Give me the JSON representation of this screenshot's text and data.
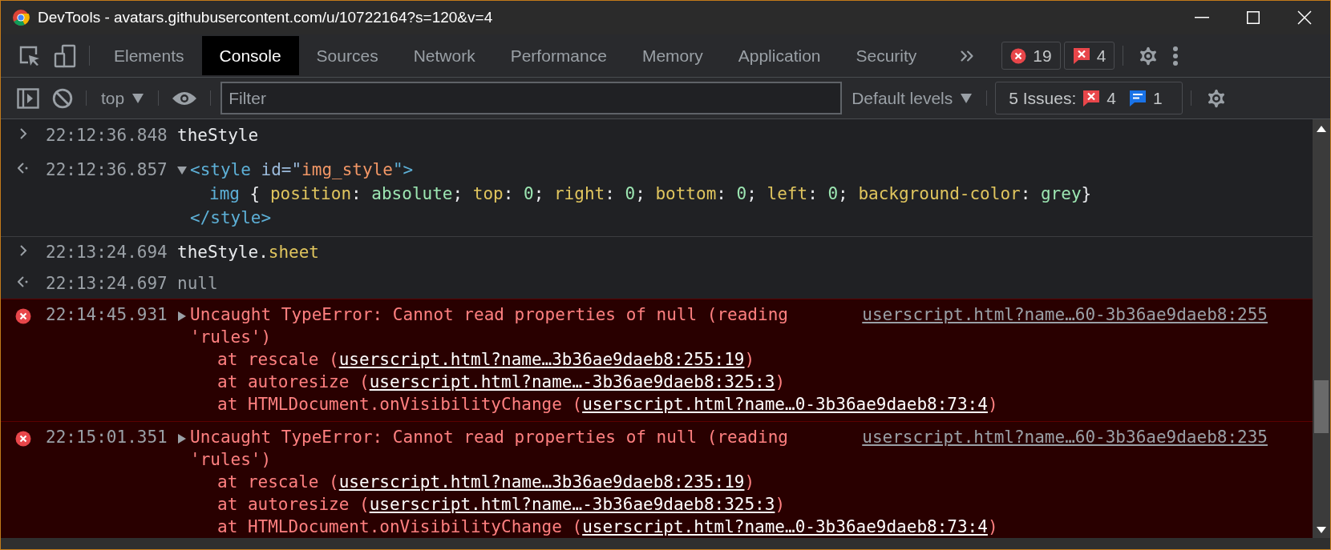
{
  "window": {
    "title": "DevTools - avatars.githubusercontent.com/u/10722164?s=120&v=4"
  },
  "tabs": [
    {
      "label": "Elements",
      "selected": false
    },
    {
      "label": "Console",
      "selected": true
    },
    {
      "label": "Sources",
      "selected": false
    },
    {
      "label": "Network",
      "selected": false
    },
    {
      "label": "Performance",
      "selected": false
    },
    {
      "label": "Memory",
      "selected": false
    },
    {
      "label": "Application",
      "selected": false
    },
    {
      "label": "Security",
      "selected": false
    }
  ],
  "badges": [
    {
      "kind": "error",
      "count": "19"
    },
    {
      "kind": "issue",
      "count": "4"
    }
  ],
  "toolbar": {
    "context": "top",
    "filter": {
      "placeholder": "Filter"
    },
    "levels": "Default levels",
    "issues": {
      "label": "5 Issues:",
      "counts": [
        {
          "kind": "issue",
          "count": "4"
        },
        {
          "kind": "info",
          "count": "1"
        }
      ]
    }
  },
  "console": [
    {
      "kind": "input",
      "time": "22:12:36.848",
      "lines": [
        [
          {
            "kind": "plain",
            "text": "theStyle"
          }
        ]
      ]
    },
    {
      "kind": "result",
      "time": "22:12:36.857",
      "expanded": true,
      "lines": [
        [
          {
            "kind": "tag",
            "text": "<style "
          },
          {
            "kind": "attr",
            "text": "id=\""
          },
          {
            "kind": "attr_value",
            "text": "img_style"
          },
          {
            "kind": "tag",
            "text": "\">"
          }
        ],
        [
          {
            "kind": "selector",
            "text": "img"
          },
          {
            "kind": "plain",
            "text": " { "
          },
          {
            "kind": "prop",
            "text": "position"
          },
          {
            "kind": "plain",
            "text": ": "
          },
          {
            "kind": "value",
            "text": "absolute"
          },
          {
            "kind": "plain",
            "text": "; "
          },
          {
            "kind": "prop",
            "text": "top"
          },
          {
            "kind": "plain",
            "text": ": "
          },
          {
            "kind": "value",
            "text": "0"
          },
          {
            "kind": "plain",
            "text": "; "
          },
          {
            "kind": "prop",
            "text": "right"
          },
          {
            "kind": "plain",
            "text": ": "
          },
          {
            "kind": "value",
            "text": "0"
          },
          {
            "kind": "plain",
            "text": "; "
          },
          {
            "kind": "prop",
            "text": "bottom"
          },
          {
            "kind": "plain",
            "text": ": "
          },
          {
            "kind": "value",
            "text": "0"
          },
          {
            "kind": "plain",
            "text": "; "
          },
          {
            "kind": "prop",
            "text": "left"
          },
          {
            "kind": "plain",
            "text": ": "
          },
          {
            "kind": "value",
            "text": "0"
          },
          {
            "kind": "plain",
            "text": "; "
          },
          {
            "kind": "prop",
            "text": "background-color"
          },
          {
            "kind": "plain",
            "text": ": "
          },
          {
            "kind": "value",
            "text": "grey"
          },
          {
            "kind": "plain",
            "text": "}"
          }
        ],
        [
          {
            "kind": "tag",
            "text": "</style>"
          }
        ]
      ]
    },
    {
      "kind": "input",
      "time": "22:13:24.694",
      "lines": [
        [
          {
            "kind": "plain",
            "text": "theStyle."
          },
          {
            "kind": "prop",
            "text": "sheet"
          }
        ]
      ]
    },
    {
      "kind": "result",
      "time": "22:13:24.697",
      "lines": [
        [
          {
            "kind": "null",
            "text": "null"
          }
        ]
      ]
    },
    {
      "kind": "error",
      "time": "22:14:45.931",
      "expanded": false,
      "message": "Uncaught TypeError: Cannot read properties of null (reading 'rules')",
      "source": "userscript.html?name…60-3b36ae9daeb8:255",
      "stack": [
        {
          "prefix": "at rescale (",
          "link": "userscript.html?name…3b36ae9daeb8:255:19",
          "suffix": ")"
        },
        {
          "prefix": "at autoresize (",
          "link": "userscript.html?name…-3b36ae9daeb8:325:3",
          "suffix": ")"
        },
        {
          "prefix": "at HTMLDocument.onVisibilityChange (",
          "link": "userscript.html?name…0-3b36ae9daeb8:73:4",
          "suffix": ")"
        }
      ]
    },
    {
      "kind": "error",
      "time": "22:15:01.351",
      "expanded": false,
      "message": "Uncaught TypeError: Cannot read properties of null (reading 'rules')",
      "source": "userscript.html?name…60-3b36ae9daeb8:235",
      "stack": [
        {
          "prefix": "at rescale (",
          "link": "userscript.html?name…3b36ae9daeb8:235:19",
          "suffix": ")"
        },
        {
          "prefix": "at autoresize (",
          "link": "userscript.html?name…-3b36ae9daeb8:325:3",
          "suffix": ")"
        },
        {
          "prefix": "at HTMLDocument.onVisibilityChange (",
          "link": "userscript.html?name…0-3b36ae9daeb8:73:4",
          "suffix": ")"
        }
      ]
    }
  ]
}
